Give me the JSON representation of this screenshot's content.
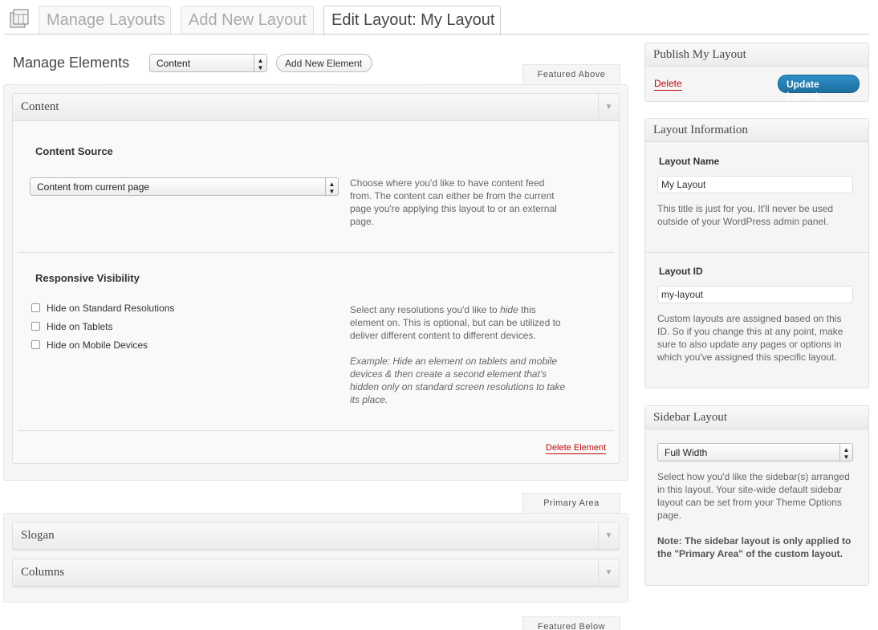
{
  "header": {
    "tabs": [
      {
        "label": "Manage Layouts"
      },
      {
        "label": "Add New Layout"
      },
      {
        "label": "Edit Layout: My Layout"
      }
    ]
  },
  "manage": {
    "title": "Manage Elements",
    "select_value": "Content",
    "add_button": "Add New Element"
  },
  "areas": {
    "featured_above": "Featured Above",
    "primary_area": "Primary Area",
    "featured_below": "Featured Below"
  },
  "content_element": {
    "title": "Content",
    "source": {
      "title": "Content Source",
      "select_value": "Content from current page",
      "description": "Choose where you'd like to have content feed from. The content can either be from the current page you're applying this layout to or an external page."
    },
    "visibility": {
      "title": "Responsive Visibility",
      "options": [
        "Hide on Standard Resolutions",
        "Hide on Tablets",
        "Hide on Mobile Devices"
      ],
      "desc_part1": "Select any resolutions you'd like to ",
      "desc_em": "hide",
      "desc_part2": " this element on. This is optional, but can be utilized to deliver different content to different devices.",
      "example": "Example: Hide an element on tablets and mobile devices & then create a second element that's hidden only on standard screen resolutions to take its place."
    },
    "delete_label": "Delete Element"
  },
  "primary_elements": [
    {
      "title": "Slogan"
    },
    {
      "title": "Columns"
    }
  ],
  "publish": {
    "title": "Publish My Layout",
    "delete_label": "Delete",
    "update_label": "Update Layout"
  },
  "layout_info": {
    "title": "Layout Information",
    "name_label": "Layout Name",
    "name_value": "My Layout",
    "name_desc": "This title is just for you. It'll never be used outside of your WordPress admin panel.",
    "id_label": "Layout ID",
    "id_value": "my-layout",
    "id_desc": "Custom layouts are assigned based on this ID. So if you change this at any point, make sure to also update any pages or options in which you've assigned this specific layout."
  },
  "sidebar_layout": {
    "title": "Sidebar Layout",
    "select_value": "Full Width",
    "desc": "Select how you'd like the sidebar(s) arranged in this layout. Your site-wide default sidebar layout can be set from your Theme Options page.",
    "note": "Note: The sidebar layout is only applied to the \"Primary Area\" of the custom layout."
  },
  "colors": {
    "accent_blue": "#2185c5",
    "delete_red": "#bc0b0b"
  }
}
